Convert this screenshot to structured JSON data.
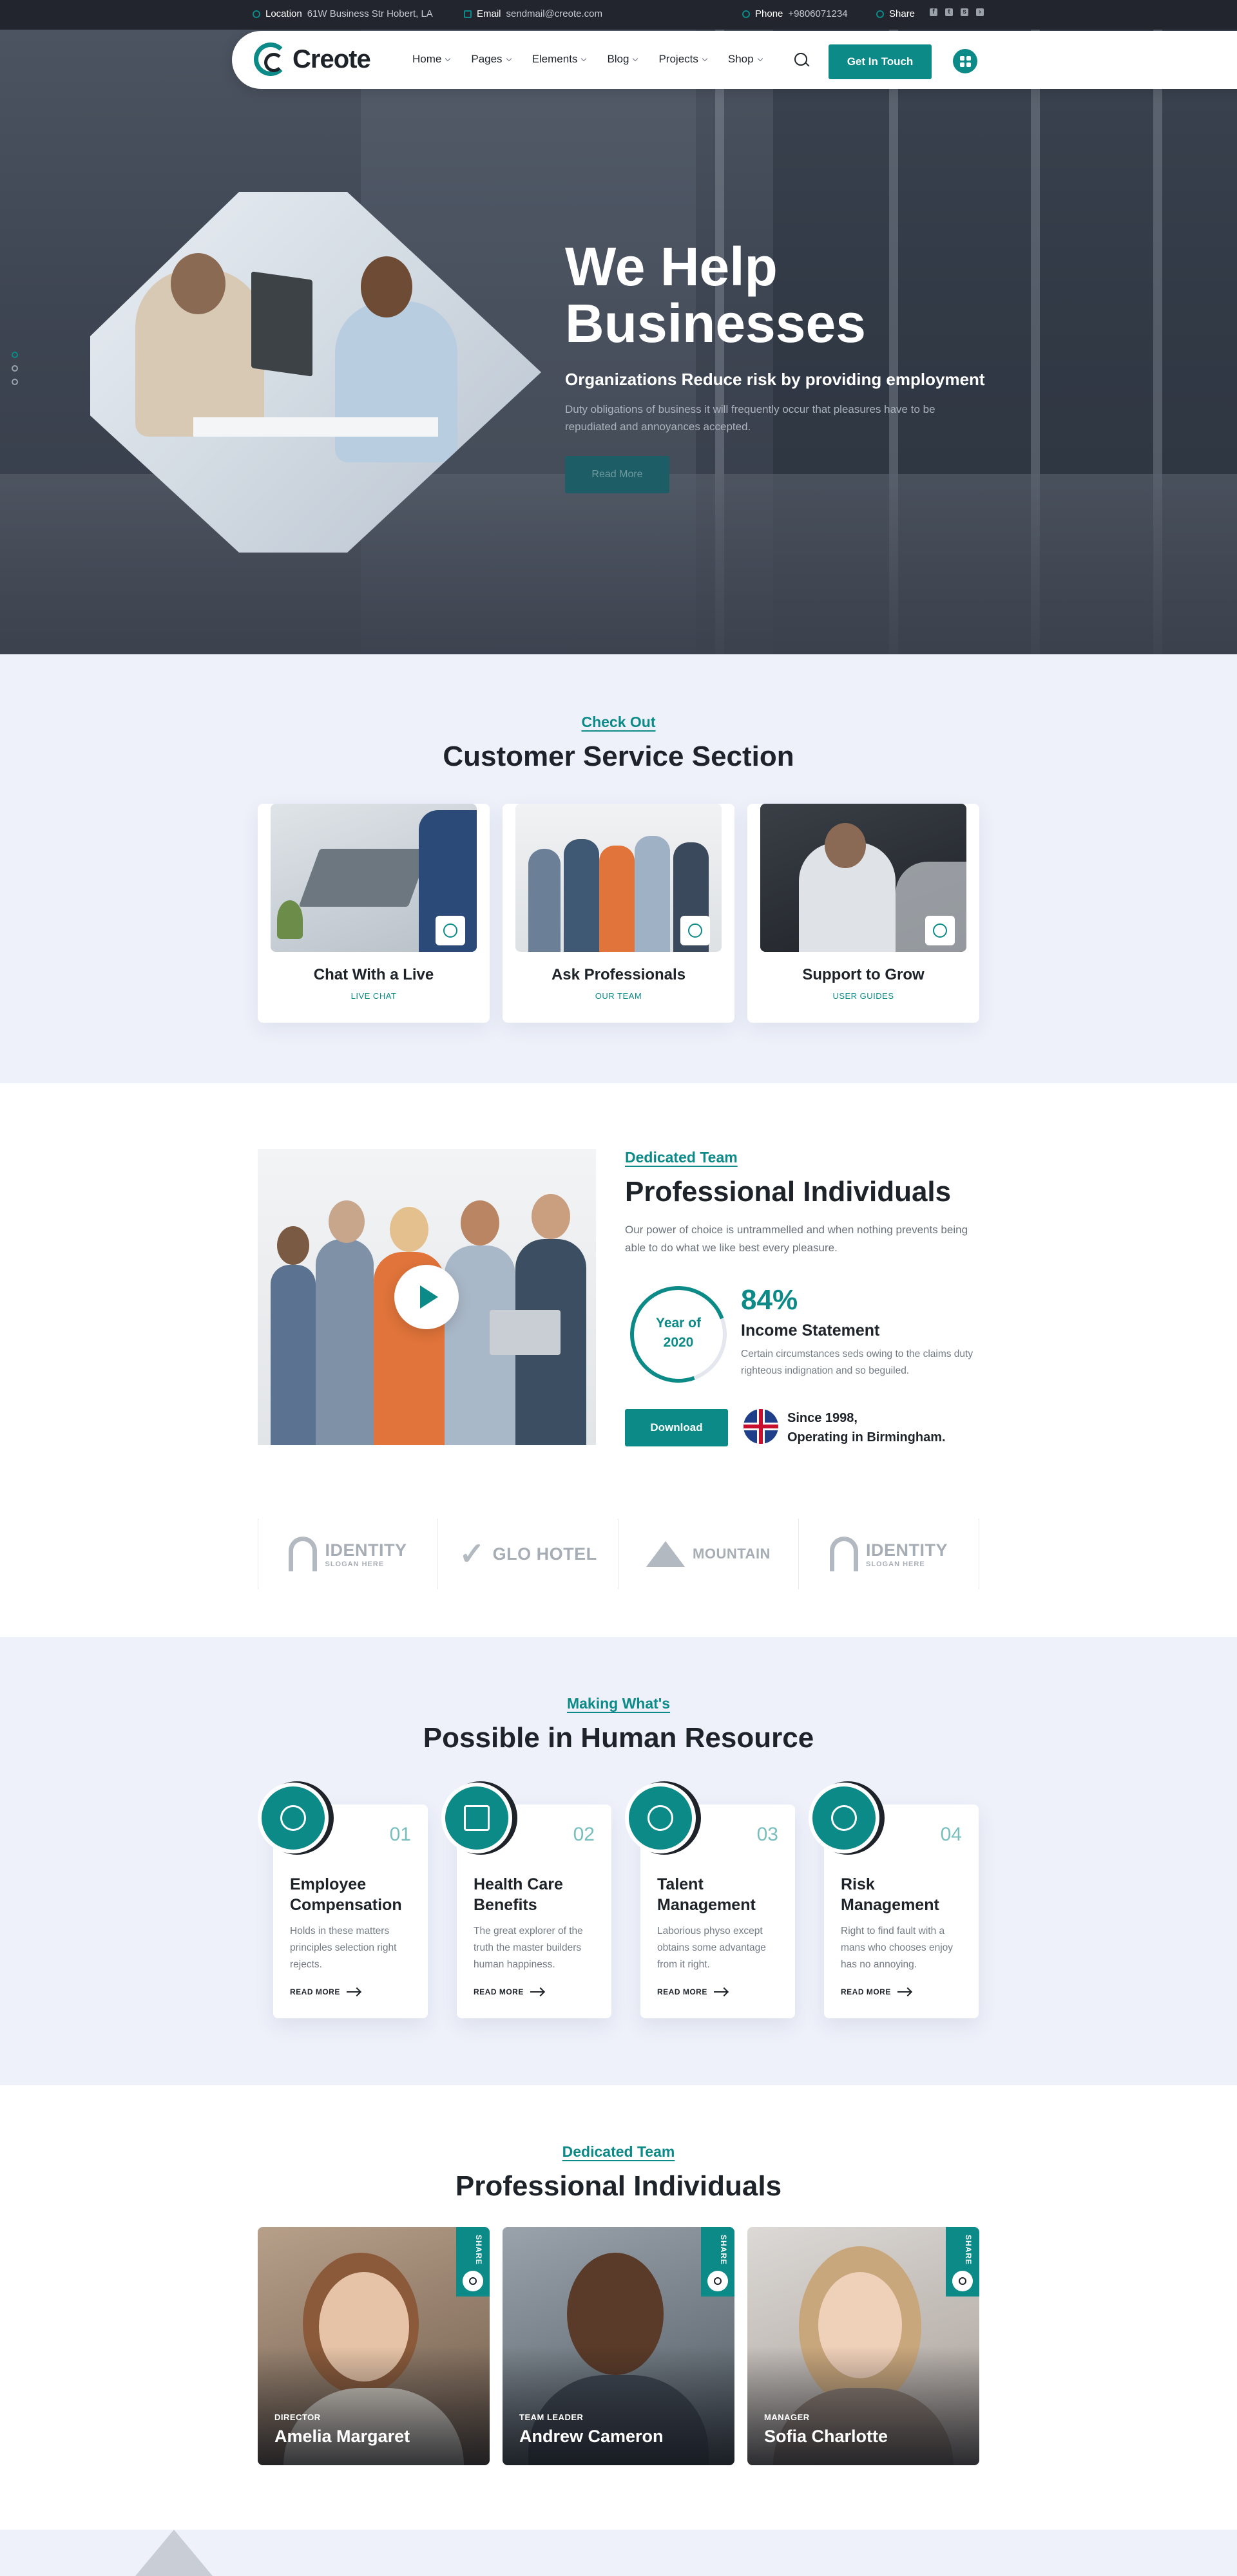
{
  "topbar": {
    "location_label": "Location",
    "location_value": "61W Business Str Hobert, LA",
    "email_label": "Email",
    "email_value": "sendmail@creote.com",
    "phone_label": "Phone",
    "phone_value": "+9806071234",
    "share_label": "Share",
    "social_icons": [
      "facebook-icon",
      "twitter-icon",
      "skype-icon",
      "telegram-icon"
    ]
  },
  "nav": {
    "logo_text": "Creote",
    "menu": [
      "Home",
      "Pages",
      "Elements",
      "Blog",
      "Projects",
      "Shop"
    ],
    "cta_label": "Get In Touch"
  },
  "hero": {
    "title_line1": "We Help",
    "title_line2": "Businesses",
    "subtitle": "Organizations Reduce risk by providing employment",
    "description": "Duty obligations of business it will frequently occur that pleasures have to be repudiated and annoyances accepted.",
    "button_label": "Read More",
    "slides": 3,
    "active_slide": 1
  },
  "services": {
    "eyebrow": "Check Out",
    "heading": "Customer Service Section",
    "cards": [
      {
        "title": "Chat With a Live",
        "subtitle": "LIVE CHAT",
        "icon": "chat-icon"
      },
      {
        "title": "Ask Professionals",
        "subtitle": "OUR TEAM",
        "icon": "user-icon"
      },
      {
        "title": "Support to Grow",
        "subtitle": "USER GUIDES",
        "icon": "location-icon"
      }
    ]
  },
  "about": {
    "eyebrow": "Dedicated Team",
    "heading": "Professional Individuals",
    "description": "Our power of choice is untrammelled and when nothing prevents being able to do what we like best every pleasure.",
    "year_label": "Year of",
    "year_value": "2020",
    "stat_value": "84%",
    "stat_title": "Income Statement",
    "stat_desc": "Certain circumstances seds owing to the claims duty righteous indignation and so beguiled.",
    "download_label": "Download",
    "since_line1": "Since 1998,",
    "since_line2": "Operating in Birmingham."
  },
  "brands": [
    {
      "name": "IDENTITY",
      "slogan": "SLOGAN HERE"
    },
    {
      "name": "GLO HOTEL",
      "slogan": ""
    },
    {
      "name": "MOUNTAIN",
      "slogan": ""
    },
    {
      "name": "IDENTITY",
      "slogan": "SLOGAN HERE"
    }
  ],
  "hr": {
    "eyebrow": "Making What's",
    "heading": "Possible in Human Resource",
    "cards": [
      {
        "num": "01",
        "title": "Employee Compensation",
        "desc": "Holds in these matters principles selection right rejects.",
        "more": "READ MORE",
        "icon": "dollar-gear-icon"
      },
      {
        "num": "02",
        "title": "Health Care Benefits",
        "desc": "The great explorer of the truth the master builders human happiness.",
        "more": "READ MORE",
        "icon": "medical-cross-icon"
      },
      {
        "num": "03",
        "title": "Talent Management",
        "desc": "Laborious physo except obtains some advantage from it right.",
        "more": "READ MORE",
        "icon": "hand-star-icon"
      },
      {
        "num": "04",
        "title": "Risk Management",
        "desc": "Right to find fault with a mans who chooses enjoy has no annoying.",
        "more": "READ MORE",
        "icon": "dollar-gear-icon"
      }
    ]
  },
  "team": {
    "eyebrow": "Dedicated Team",
    "heading": "Professional Individuals",
    "share_label": "SHARE",
    "members": [
      {
        "role": "DIRECTOR",
        "name": "Amelia Margaret"
      },
      {
        "role": "TEAM LEADER",
        "name": "Andrew Cameron"
      },
      {
        "role": "MANAGER",
        "name": "Sofia Charlotte"
      }
    ]
  },
  "colors": {
    "accent": "#0b8a88",
    "dark": "#1d2329",
    "topbar": "#22252d",
    "section_light": "#eef1fa"
  }
}
